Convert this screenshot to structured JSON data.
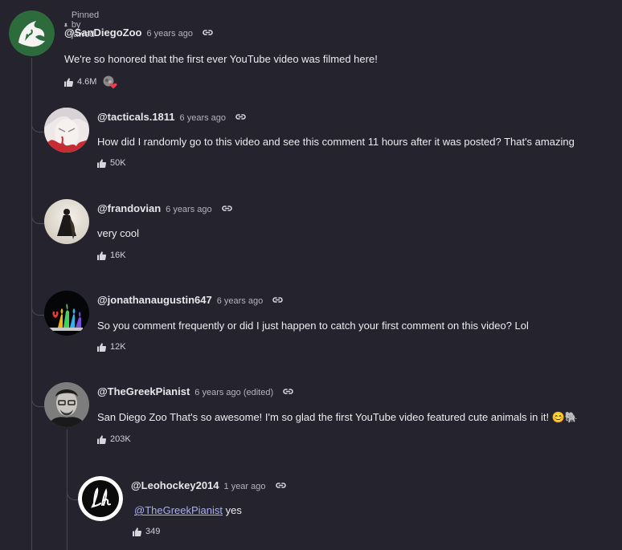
{
  "pinned": {
    "label": "Pinned by jawed"
  },
  "comments": [
    {
      "author": "@SanDiegoZoo",
      "time": "6 years ago",
      "text": "We're so honored that the first ever YouTube video was filmed here!",
      "likes": "4.6M"
    },
    {
      "author": "@tacticals.1811",
      "time": "6 years ago",
      "text": "How did I randomly go to this video and see this comment 11 hours after it was posted? That's amazing",
      "likes": "50K"
    },
    {
      "author": "@frandovian",
      "time": "6 years ago",
      "text": "very cool",
      "likes": "16K"
    },
    {
      "author": "@jonathanaugustin647",
      "time": "6 years ago",
      "text": "So you comment frequently or did I just happen to catch your first comment on this video? Lol",
      "likes": "12K"
    },
    {
      "author": "@TheGreekPianist",
      "time": "6 years ago (edited)",
      "text": "San Diego Zoo That's so awesome! I'm so glad the first YouTube video featured cute animals in it! 😊🐘",
      "likes": "203K"
    },
    {
      "author": "@Leohockey2014",
      "time": "1 year ago",
      "mention": "@TheGreekPianist",
      "text": "yes",
      "likes": "349"
    }
  ],
  "icons": {
    "pin": "pin-icon",
    "link": "link-icon",
    "like": "thumbs-up-icon",
    "heart": "creator-heart-icon"
  },
  "colors": {
    "background": "#24232e",
    "zoo_green": "#2e6b3c",
    "mention": "#a9aff0",
    "heart": "#e8404e"
  }
}
